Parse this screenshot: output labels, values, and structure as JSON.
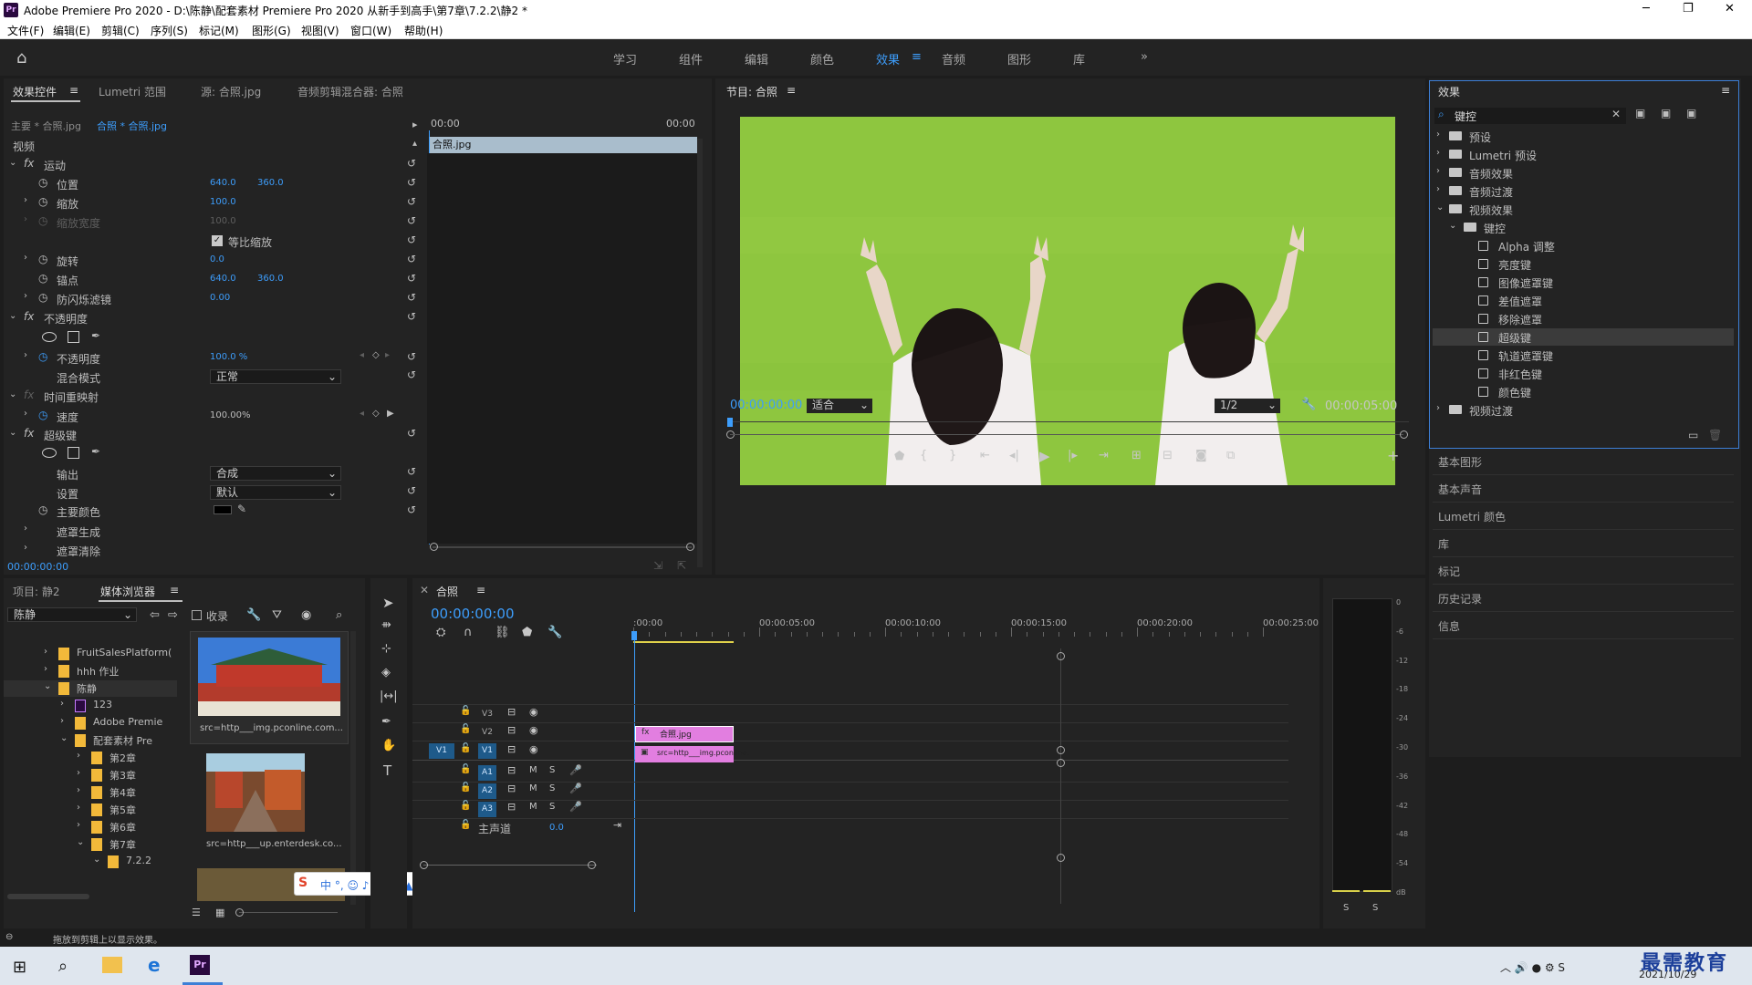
{
  "window": {
    "title": "Adobe Premiere Pro 2020 - D:\\陈静\\配套素材 Premiere Pro 2020 从新手到高手\\第7章\\7.2.2\\静2 *",
    "app_badge": "Pr"
  },
  "menu": [
    "文件(F)",
    "编辑(E)",
    "剪辑(C)",
    "序列(S)",
    "标记(M)",
    "图形(G)",
    "视图(V)",
    "窗口(W)",
    "帮助(H)"
  ],
  "workspaces": {
    "items": [
      "学习",
      "组件",
      "编辑",
      "颜色",
      "效果",
      "音频",
      "图形",
      "库"
    ],
    "active": "效果"
  },
  "effect_controls": {
    "tabs": [
      "效果控件",
      "Lumetri 范围",
      "源: 合照.jpg",
      "音频剪辑混合器: 合照"
    ],
    "master": "主要 * 合照.jpg",
    "clip": "合照 * 合照.jpg",
    "ruler_start": "00:00",
    "ruler_end": "00:00",
    "clip_bar": "合照.jpg",
    "video_header": "视频",
    "motion": "运动",
    "position_label": "位置",
    "position_x": "640.0",
    "position_y": "360.0",
    "scale_label": "缩放",
    "scale": "100.0",
    "scale_width_label": "缩放宽度",
    "scale_width": "100.0",
    "uniform_label": "等比缩放",
    "rotation_label": "旋转",
    "rotation": "0.0",
    "anchor_label": "锚点",
    "anchor_x": "640.0",
    "anchor_y": "360.0",
    "flicker_label": "防闪烁滤镜",
    "flicker": "0.00",
    "opacity_header": "不透明度",
    "opacity_label": "不透明度",
    "opacity": "100.0 %",
    "blend_label": "混合模式",
    "blend": "正常",
    "timeremap_header": "时间重映射",
    "speed_label": "速度",
    "speed": "100.00%",
    "ultrakey_header": "超级键",
    "output_label": "输出",
    "output": "合成",
    "setting_label": "设置",
    "setting": "默认",
    "keycolor_label": "主要颜色",
    "matte_gen": "遮罩生成",
    "matte_clean": "遮罩清除",
    "timecode": "00:00:00:00"
  },
  "program": {
    "title": "节目: 合照",
    "timecode": "00:00:00:00",
    "fit": "适合",
    "res": "1/2",
    "duration": "00:00:05:00",
    "bg": "#8ec63f"
  },
  "effects": {
    "title": "效果",
    "search": "键控",
    "items": [
      {
        "label": "预设",
        "indent": 0,
        "type": "bin",
        "arrow": "›"
      },
      {
        "label": "Lumetri 预设",
        "indent": 0,
        "type": "bin",
        "arrow": "›"
      },
      {
        "label": "音频效果",
        "indent": 0,
        "type": "folder",
        "arrow": "›"
      },
      {
        "label": "音频过渡",
        "indent": 0,
        "type": "folder",
        "arrow": "›"
      },
      {
        "label": "视频效果",
        "indent": 0,
        "type": "folder",
        "arrow": "⌄"
      },
      {
        "label": "键控",
        "indent": 1,
        "type": "folder",
        "arrow": "⌄"
      },
      {
        "label": "Alpha 调整",
        "indent": 2,
        "type": "fx",
        "arrow": ""
      },
      {
        "label": "亮度键",
        "indent": 2,
        "type": "fx",
        "arrow": ""
      },
      {
        "label": "图像遮罩键",
        "indent": 2,
        "type": "fx",
        "arrow": ""
      },
      {
        "label": "差值遮罩",
        "indent": 2,
        "type": "fx",
        "arrow": ""
      },
      {
        "label": "移除遮罩",
        "indent": 2,
        "type": "fx",
        "arrow": ""
      },
      {
        "label": "超级键",
        "indent": 2,
        "type": "fx",
        "arrow": "",
        "selected": true
      },
      {
        "label": "轨道遮罩键",
        "indent": 2,
        "type": "fx",
        "arrow": ""
      },
      {
        "label": "非红色键",
        "indent": 2,
        "type": "fx",
        "arrow": ""
      },
      {
        "label": "颜色键",
        "indent": 2,
        "type": "fx",
        "arrow": ""
      },
      {
        "label": "视频过渡",
        "indent": 0,
        "type": "folder",
        "arrow": "›"
      }
    ],
    "side_panels": [
      "基本图形",
      "基本声音",
      "Lumetri 颜色",
      "库",
      "标记",
      "历史记录",
      "信息"
    ]
  },
  "project": {
    "tabs": [
      "项目: 静2",
      "媒体浏览器"
    ],
    "path": "陈静",
    "favorite": "收录",
    "tree": [
      {
        "label": "FruitSalesPlatform(",
        "indent": 0,
        "arrow": "›",
        "kind": "folder"
      },
      {
        "label": "hhh 作业",
        "indent": 0,
        "arrow": "›",
        "kind": "folder"
      },
      {
        "label": "陈静",
        "indent": 0,
        "arrow": "⌄",
        "kind": "folder"
      },
      {
        "label": "123",
        "indent": 1,
        "arrow": "›",
        "kind": "pr"
      },
      {
        "label": "Adobe Premie",
        "indent": 1,
        "arrow": "›",
        "kind": "folder"
      },
      {
        "label": "配套素材 Pre",
        "indent": 1,
        "arrow": "⌄",
        "kind": "folder"
      },
      {
        "label": "第2章",
        "indent": 2,
        "arrow": "›",
        "kind": "folder"
      },
      {
        "label": "第3章",
        "indent": 2,
        "arrow": "›",
        "kind": "folder"
      },
      {
        "label": "第4章",
        "indent": 2,
        "arrow": "›",
        "kind": "folder"
      },
      {
        "label": "第5章",
        "indent": 2,
        "arrow": "›",
        "kind": "folder"
      },
      {
        "label": "第6章",
        "indent": 2,
        "arrow": "›",
        "kind": "folder"
      },
      {
        "label": "第7章",
        "indent": 2,
        "arrow": "⌄",
        "kind": "folder"
      },
      {
        "label": "7.2.2",
        "indent": 3,
        "arrow": "⌄",
        "kind": "folder"
      }
    ],
    "thumbs": [
      "src=http___img.pconline.com...",
      "src=http___up.enterdesk.co..."
    ]
  },
  "timeline": {
    "title": "合照",
    "timecode": "00:00:00:00",
    "ticks": [
      ":00:00",
      "00:00:05:00",
      "00:00:10:00",
      "00:00:15:00",
      "00:00:20:00",
      "00:00:25:00"
    ],
    "video_tracks": [
      "V3",
      "V2",
      "V1"
    ],
    "audio_tracks": [
      "A1",
      "A2",
      "A3"
    ],
    "master": "主声道",
    "master_val": "0.0",
    "clip_v2": "合照.jpg",
    "clip_v1": "src=http___img.pconline.",
    "clip_color": "#e27ee0"
  },
  "meter": {
    "scale": [
      "0",
      "-6",
      "-12",
      "-18",
      "-24",
      "-30",
      "-36",
      "-42",
      "-48",
      "-54",
      "dB"
    ],
    "solo": [
      "S",
      "S"
    ]
  },
  "status": {
    "hint": "拖放到剪辑上以显示效果。"
  },
  "taskbar": {
    "date": "2021/10/29",
    "watermark": "最需教育"
  }
}
